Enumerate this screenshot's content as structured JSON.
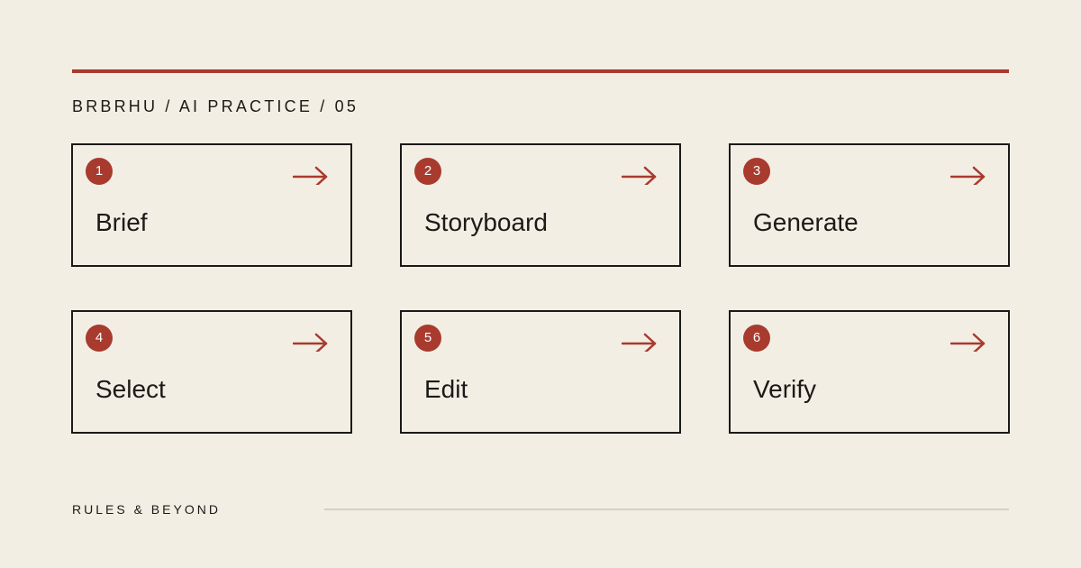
{
  "header": {
    "kicker": "BRBRHU / AI PRACTICE / 05"
  },
  "steps": [
    {
      "number": "1",
      "label": "Brief",
      "arrow_icon": "arrow-right-icon"
    },
    {
      "number": "2",
      "label": "Storyboard",
      "arrow_icon": "arrow-right-icon"
    },
    {
      "number": "3",
      "label": "Generate",
      "arrow_icon": "arrow-right-icon"
    },
    {
      "number": "4",
      "label": "Select",
      "arrow_icon": "arrow-right-icon"
    },
    {
      "number": "5",
      "label": "Edit",
      "arrow_icon": "arrow-right-icon"
    },
    {
      "number": "6",
      "label": "Verify",
      "arrow_icon": "arrow-right-icon"
    }
  ],
  "footer": {
    "label": "RULES & BEYOND"
  },
  "colors": {
    "background": "#f3eee4",
    "accent": "#a83a2e",
    "ink": "#1c1a17",
    "rule_light": "#d5d0c6"
  }
}
